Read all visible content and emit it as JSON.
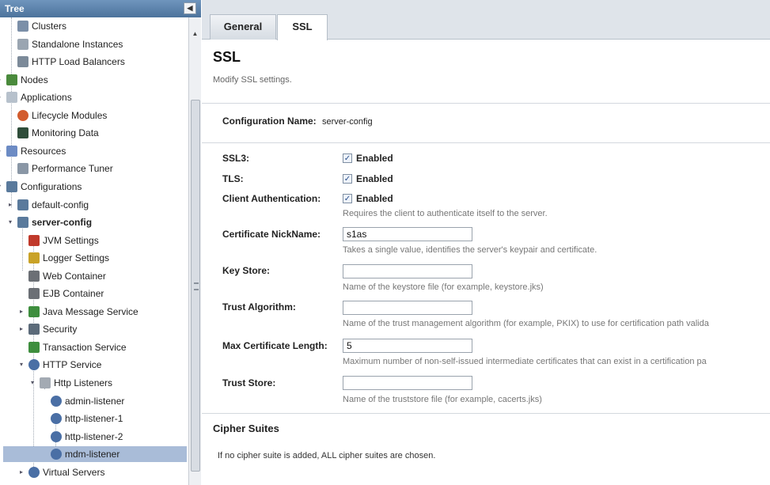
{
  "tree": {
    "header": "Tree",
    "collapse_icon": "◀",
    "items": [
      {
        "label": "Clusters",
        "icon": "clusters-icon",
        "color": "#7b8fa8",
        "toggle": ""
      },
      {
        "label": "Standalone Instances",
        "icon": "instance-icon",
        "color": "#9aa5b1",
        "toggle": ""
      },
      {
        "label": "HTTP Load Balancers",
        "icon": "balance-icon",
        "color": "#7c8a99",
        "toggle": ""
      },
      {
        "label": "Nodes",
        "icon": "nodes-icon",
        "color": "#4a8a3c",
        "toggle": "▸"
      },
      {
        "label": "Applications",
        "icon": "applications-icon",
        "color": "#b7c1cc",
        "toggle": "▸"
      },
      {
        "label": "Lifecycle Modules",
        "icon": "lifecycle-icon",
        "color": "#d25c2e",
        "toggle": ""
      },
      {
        "label": "Monitoring Data",
        "icon": "monitor-icon",
        "color": "#2f4d3a",
        "toggle": ""
      },
      {
        "label": "Resources",
        "icon": "resources-icon",
        "color": "#6c8bc4",
        "toggle": "▸"
      },
      {
        "label": "Performance Tuner",
        "icon": "tuner-icon",
        "color": "#8a97a6",
        "toggle": ""
      },
      {
        "label": "Configurations",
        "icon": "configurations-icon",
        "color": "#5a7a9c",
        "toggle": "▾"
      },
      {
        "label": "default-config",
        "icon": "config-icon",
        "color": "#5a7a9c",
        "toggle": "▸"
      },
      {
        "label": "server-config",
        "icon": "config-icon",
        "color": "#5a7a9c",
        "toggle": "▾",
        "bold": true
      },
      {
        "label": "JVM Settings",
        "icon": "jvm-icon",
        "color": "#c0392b",
        "toggle": ""
      },
      {
        "label": "Logger Settings",
        "icon": "logger-icon",
        "color": "#c9a227",
        "toggle": ""
      },
      {
        "label": "Web Container",
        "icon": "container-icon",
        "color": "#6b6f75",
        "toggle": ""
      },
      {
        "label": "EJB Container",
        "icon": "container-icon",
        "color": "#6b6f75",
        "toggle": ""
      },
      {
        "label": "Java Message Service",
        "icon": "jms-icon",
        "color": "#3e8e3e",
        "toggle": "▸"
      },
      {
        "label": "Security",
        "icon": "lock-icon",
        "color": "#5c6b7a",
        "toggle": "▸"
      },
      {
        "label": "Transaction Service",
        "icon": "transaction-icon",
        "color": "#3e8e3e",
        "toggle": ""
      },
      {
        "label": "HTTP Service",
        "icon": "http-service-icon",
        "color": "#4a6fa5",
        "toggle": "▾"
      },
      {
        "label": "Http Listeners",
        "icon": "folder-icon",
        "color": "#a3aab3",
        "toggle": "▾"
      },
      {
        "label": "admin-listener",
        "icon": "listener-icon",
        "color": "#4a6fa5",
        "toggle": ""
      },
      {
        "label": "http-listener-1",
        "icon": "listener-icon",
        "color": "#4a6fa5",
        "toggle": ""
      },
      {
        "label": "http-listener-2",
        "icon": "listener-icon",
        "color": "#4a6fa5",
        "toggle": ""
      },
      {
        "label": "mdm-listener",
        "icon": "listener-icon",
        "color": "#4a6fa5",
        "toggle": "",
        "selected": true
      },
      {
        "label": "Virtual Servers",
        "icon": "virtual-server-icon",
        "color": "#4a6fa5",
        "toggle": "▸"
      }
    ]
  },
  "tabs": [
    {
      "label": "General",
      "active": false
    },
    {
      "label": "SSL",
      "active": true
    }
  ],
  "page": {
    "title": "SSL",
    "subtitle": "Modify SSL settings.",
    "config_label": "Configuration Name:",
    "config_value": "server-config"
  },
  "form": {
    "ssl3_label": "SSL3:",
    "ssl3_text": "Enabled",
    "tls_label": "TLS:",
    "tls_text": "Enabled",
    "client_auth_label": "Client Authentication:",
    "client_auth_text": "Enabled",
    "client_auth_help": "Requires the client to authenticate itself to the server.",
    "check_mark": "✓",
    "nickname_label": "Certificate NickName:",
    "nickname_value": "s1as",
    "nickname_help": "Takes a single value, identifies the server's keypair and certificate.",
    "keystore_label": "Key Store:",
    "keystore_value": "",
    "keystore_help": "Name of the keystore file (for example, keystore.jks)",
    "trust_algorithm_label": "Trust Algorithm:",
    "trust_algorithm_value": "",
    "trust_algorithm_help": "Name of the trust management algorithm (for example, PKIX) to use for certification path valida",
    "max_cert_label": "Max Certificate Length:",
    "max_cert_value": "5",
    "max_cert_help": "Maximum number of non-self-issued intermediate certificates that can exist in a certification pa",
    "truststore_label": "Trust Store:",
    "truststore_value": "",
    "truststore_help": "Name of the truststore file (for example, cacerts.jks)"
  },
  "cipher": {
    "heading": "Cipher Suites",
    "note": "If no cipher suite is added, ALL cipher suites are chosen."
  }
}
